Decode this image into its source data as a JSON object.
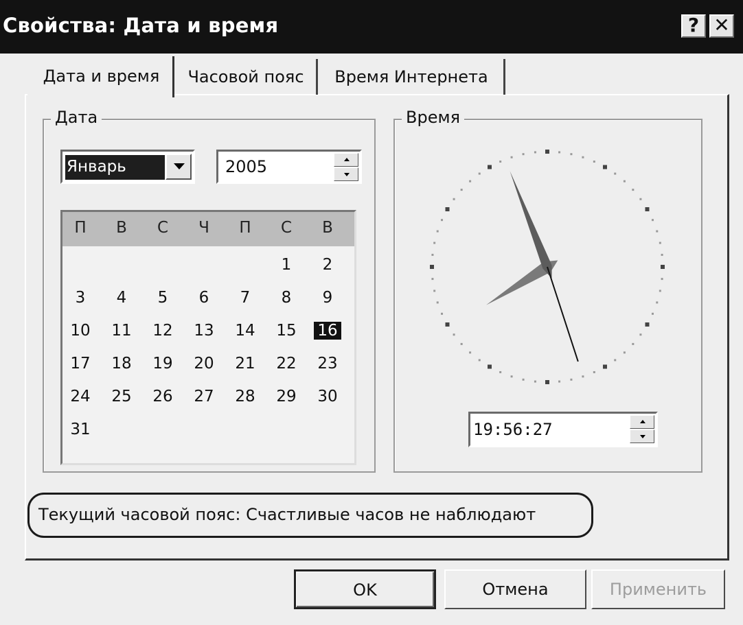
{
  "window": {
    "title": "Свойства: Дата и время",
    "help_glyph": "?",
    "close_glyph": "✕"
  },
  "tabs": [
    {
      "label": "Дата и время",
      "selected": true
    },
    {
      "label": "Часовой пояс",
      "selected": false
    },
    {
      "label": "Время Интернета",
      "selected": false
    }
  ],
  "date": {
    "group_label": "Дата",
    "month": "Январь",
    "year": "2005",
    "weekdays": [
      "П",
      "В",
      "С",
      "Ч",
      "П",
      "С",
      "В"
    ],
    "weeks": [
      [
        "",
        "",
        "",
        "",
        "",
        "1",
        "2"
      ],
      [
        "3",
        "4",
        "5",
        "6",
        "7",
        "8",
        "9"
      ],
      [
        "10",
        "11",
        "12",
        "13",
        "14",
        "15",
        "16"
      ],
      [
        "17",
        "18",
        "19",
        "20",
        "21",
        "22",
        "23"
      ],
      [
        "24",
        "25",
        "26",
        "27",
        "28",
        "29",
        "30"
      ],
      [
        "31",
        "",
        "",
        "",
        "",
        "",
        ""
      ]
    ],
    "selected_day": "16"
  },
  "time": {
    "group_label": "Время",
    "value": "19:56:27"
  },
  "timezone_note": "Текущий часовой пояс: Счастливые часов не наблюдают",
  "buttons": {
    "ok": "OK",
    "cancel": "Отмена",
    "apply": "Применить"
  },
  "icons": {
    "dropdown": "chevron-down-icon",
    "spin_up": "spin-up-icon",
    "spin_down": "spin-down-icon"
  }
}
